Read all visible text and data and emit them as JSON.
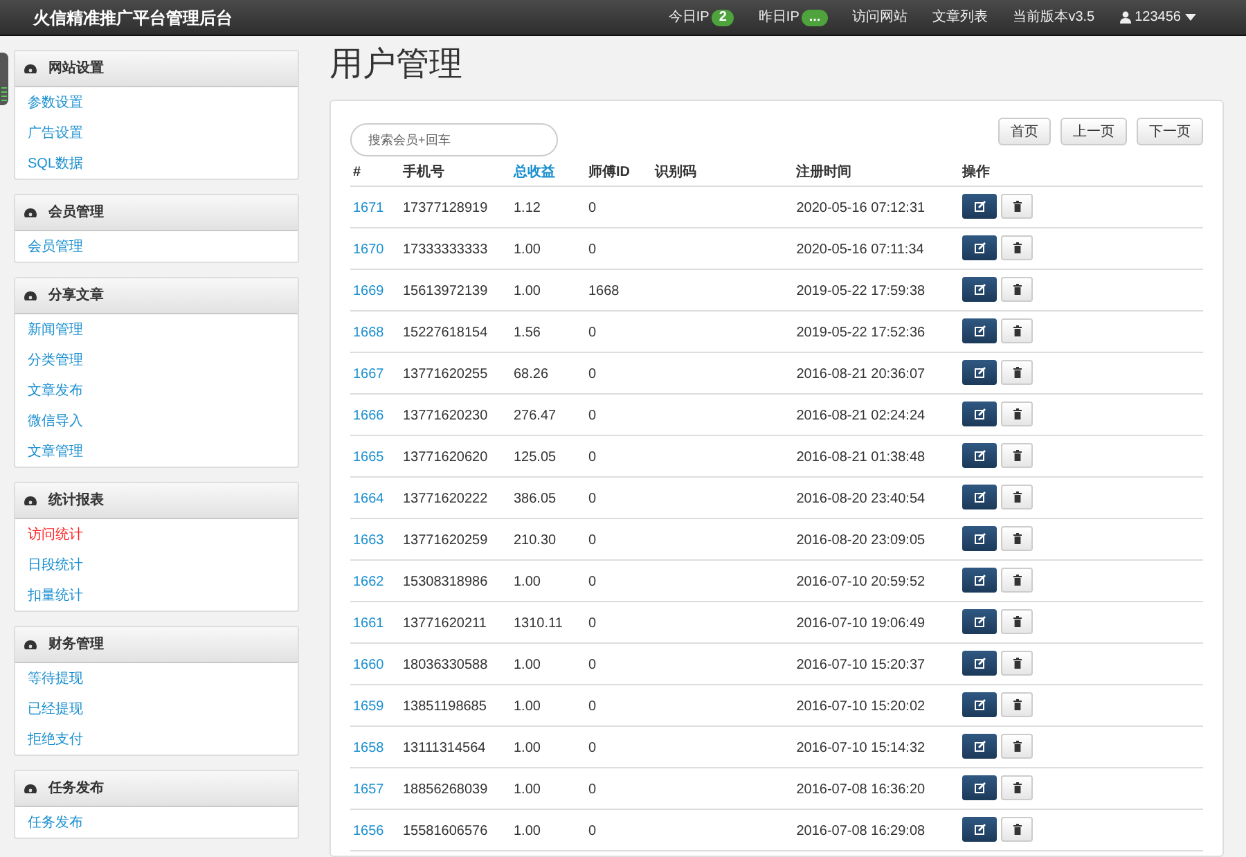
{
  "topbar": {
    "title": "火信精准推广平台管理后台",
    "stats": [
      {
        "label": "今日IP",
        "badge": "2"
      },
      {
        "label": "昨日IP",
        "badge": "..."
      }
    ],
    "links": [
      "访问网站",
      "文章列表",
      "当前版本v3.5"
    ],
    "user": "123456"
  },
  "sidebar": [
    {
      "title": "网站设置",
      "items": [
        {
          "label": "参数设置",
          "selected": false
        },
        {
          "label": "广告设置",
          "selected": false
        },
        {
          "label": "SQL数据",
          "selected": false
        }
      ]
    },
    {
      "title": "会员管理",
      "items": [
        {
          "label": "会员管理",
          "selected": false
        }
      ]
    },
    {
      "title": "分享文章",
      "items": [
        {
          "label": "新闻管理",
          "selected": false
        },
        {
          "label": "分类管理",
          "selected": false
        },
        {
          "label": "文章发布",
          "selected": false
        },
        {
          "label": "微信导入",
          "selected": false
        },
        {
          "label": "文章管理",
          "selected": false
        }
      ]
    },
    {
      "title": "统计报表",
      "items": [
        {
          "label": "访问统计",
          "selected": true
        },
        {
          "label": "日段统计",
          "selected": false
        },
        {
          "label": "扣量统计",
          "selected": false
        }
      ]
    },
    {
      "title": "财务管理",
      "items": [
        {
          "label": "等待提现",
          "selected": false
        },
        {
          "label": "已经提现",
          "selected": false
        },
        {
          "label": "拒绝支付",
          "selected": false
        }
      ]
    },
    {
      "title": "任务发布",
      "items": [
        {
          "label": "任务发布",
          "selected": false
        }
      ]
    }
  ],
  "page_title": "用户管理",
  "search": {
    "placeholder": "搜索会员+回车"
  },
  "pager": [
    "首页",
    "上一页",
    "下一页"
  ],
  "table": {
    "columns": [
      {
        "label": "#",
        "link": false
      },
      {
        "label": "手机号",
        "link": false
      },
      {
        "label": "总收益",
        "link": true
      },
      {
        "label": "师傅ID",
        "link": false
      },
      {
        "label": "识别码",
        "link": false
      },
      {
        "label": "注册时间",
        "link": false
      },
      {
        "label": "操作",
        "link": false
      }
    ],
    "rows": [
      [
        "1671",
        "17377128919",
        "1.12",
        "0",
        "",
        "2020-05-16 07:12:31"
      ],
      [
        "1670",
        "17333333333",
        "1.00",
        "0",
        "",
        "2020-05-16 07:11:34"
      ],
      [
        "1669",
        "15613972139",
        "1.00",
        "1668",
        "",
        "2019-05-22 17:59:38"
      ],
      [
        "1668",
        "15227618154",
        "1.56",
        "0",
        "",
        "2019-05-22 17:52:36"
      ],
      [
        "1667",
        "13771620255",
        "68.26",
        "0",
        "",
        "2016-08-21 20:36:07"
      ],
      [
        "1666",
        "13771620230",
        "276.47",
        "0",
        "",
        "2016-08-21 02:24:24"
      ],
      [
        "1665",
        "13771620620",
        "125.05",
        "0",
        "",
        "2016-08-21 01:38:48"
      ],
      [
        "1664",
        "13771620222",
        "386.05",
        "0",
        "",
        "2016-08-20 23:40:54"
      ],
      [
        "1663",
        "13771620259",
        "210.30",
        "0",
        "",
        "2016-08-20 23:09:05"
      ],
      [
        "1662",
        "15308318986",
        "1.00",
        "0",
        "",
        "2016-07-10 20:59:52"
      ],
      [
        "1661",
        "13771620211",
        "1310.11",
        "0",
        "",
        "2016-07-10 19:06:49"
      ],
      [
        "1660",
        "18036330588",
        "1.00",
        "0",
        "",
        "2016-07-10 15:20:37"
      ],
      [
        "1659",
        "13851198685",
        "1.00",
        "0",
        "",
        "2016-07-10 15:20:02"
      ],
      [
        "1658",
        "13111314564",
        "1.00",
        "0",
        "",
        "2016-07-10 15:14:32"
      ],
      [
        "1657",
        "18856268039",
        "1.00",
        "0",
        "",
        "2016-07-08 16:36:20"
      ],
      [
        "1656",
        "15581606576",
        "1.00",
        "0",
        "",
        "2016-07-08 16:29:08"
      ]
    ]
  }
}
